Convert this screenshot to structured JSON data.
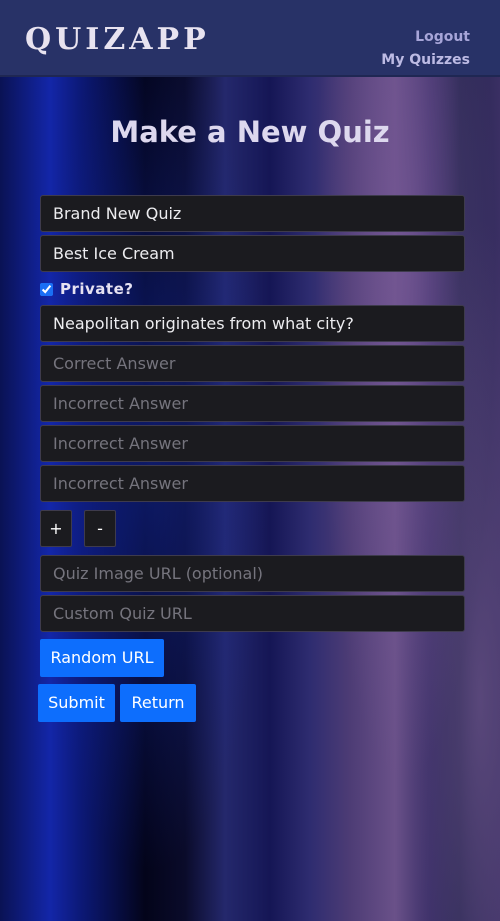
{
  "navbar": {
    "logo": "QUIZAPP",
    "logout_label": "Logout",
    "my_quizzes_label": "My Quizzes"
  },
  "page": {
    "title": "Make a New Quiz"
  },
  "form": {
    "quiz_title": {
      "value": "Brand New Quiz"
    },
    "quiz_category": {
      "value": "Best Ice Cream"
    },
    "private": {
      "label": "Private?",
      "checked": true
    },
    "question": {
      "value": "Neapolitan originates from what city?"
    },
    "correct_answer": {
      "placeholder": "Correct Answer",
      "value": ""
    },
    "incorrect_answers": [
      {
        "placeholder": "Incorrect Answer",
        "value": ""
      },
      {
        "placeholder": "Incorrect Answer",
        "value": ""
      },
      {
        "placeholder": "Incorrect Answer",
        "value": ""
      }
    ],
    "add_question_label": "+",
    "remove_question_label": "-",
    "image_url": {
      "placeholder": "Quiz Image URL (optional)",
      "value": ""
    },
    "custom_url": {
      "placeholder": "Custom Quiz URL",
      "value": ""
    },
    "random_url_label": "Random URL",
    "submit_label": "Submit",
    "return_label": "Return"
  },
  "colors": {
    "navbar_bg": "#283267",
    "button_primary": "#0d6efd",
    "input_bg": "#1b1b1f"
  }
}
